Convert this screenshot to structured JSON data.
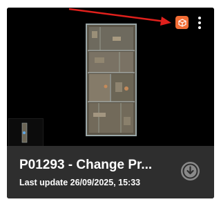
{
  "card": {
    "title": "P01293 - Change Pr...",
    "last_update": "Last update 26/09/2025, 15:33"
  },
  "icons": {
    "menu": "more-vertical-icon",
    "cube": "3d-cube-icon",
    "download": "download-icon"
  },
  "colors": {
    "card_bg": "#2e2e2e",
    "preview_bg": "#000000",
    "accent": "#f26d35",
    "annotation_arrow": "#e0201c"
  }
}
